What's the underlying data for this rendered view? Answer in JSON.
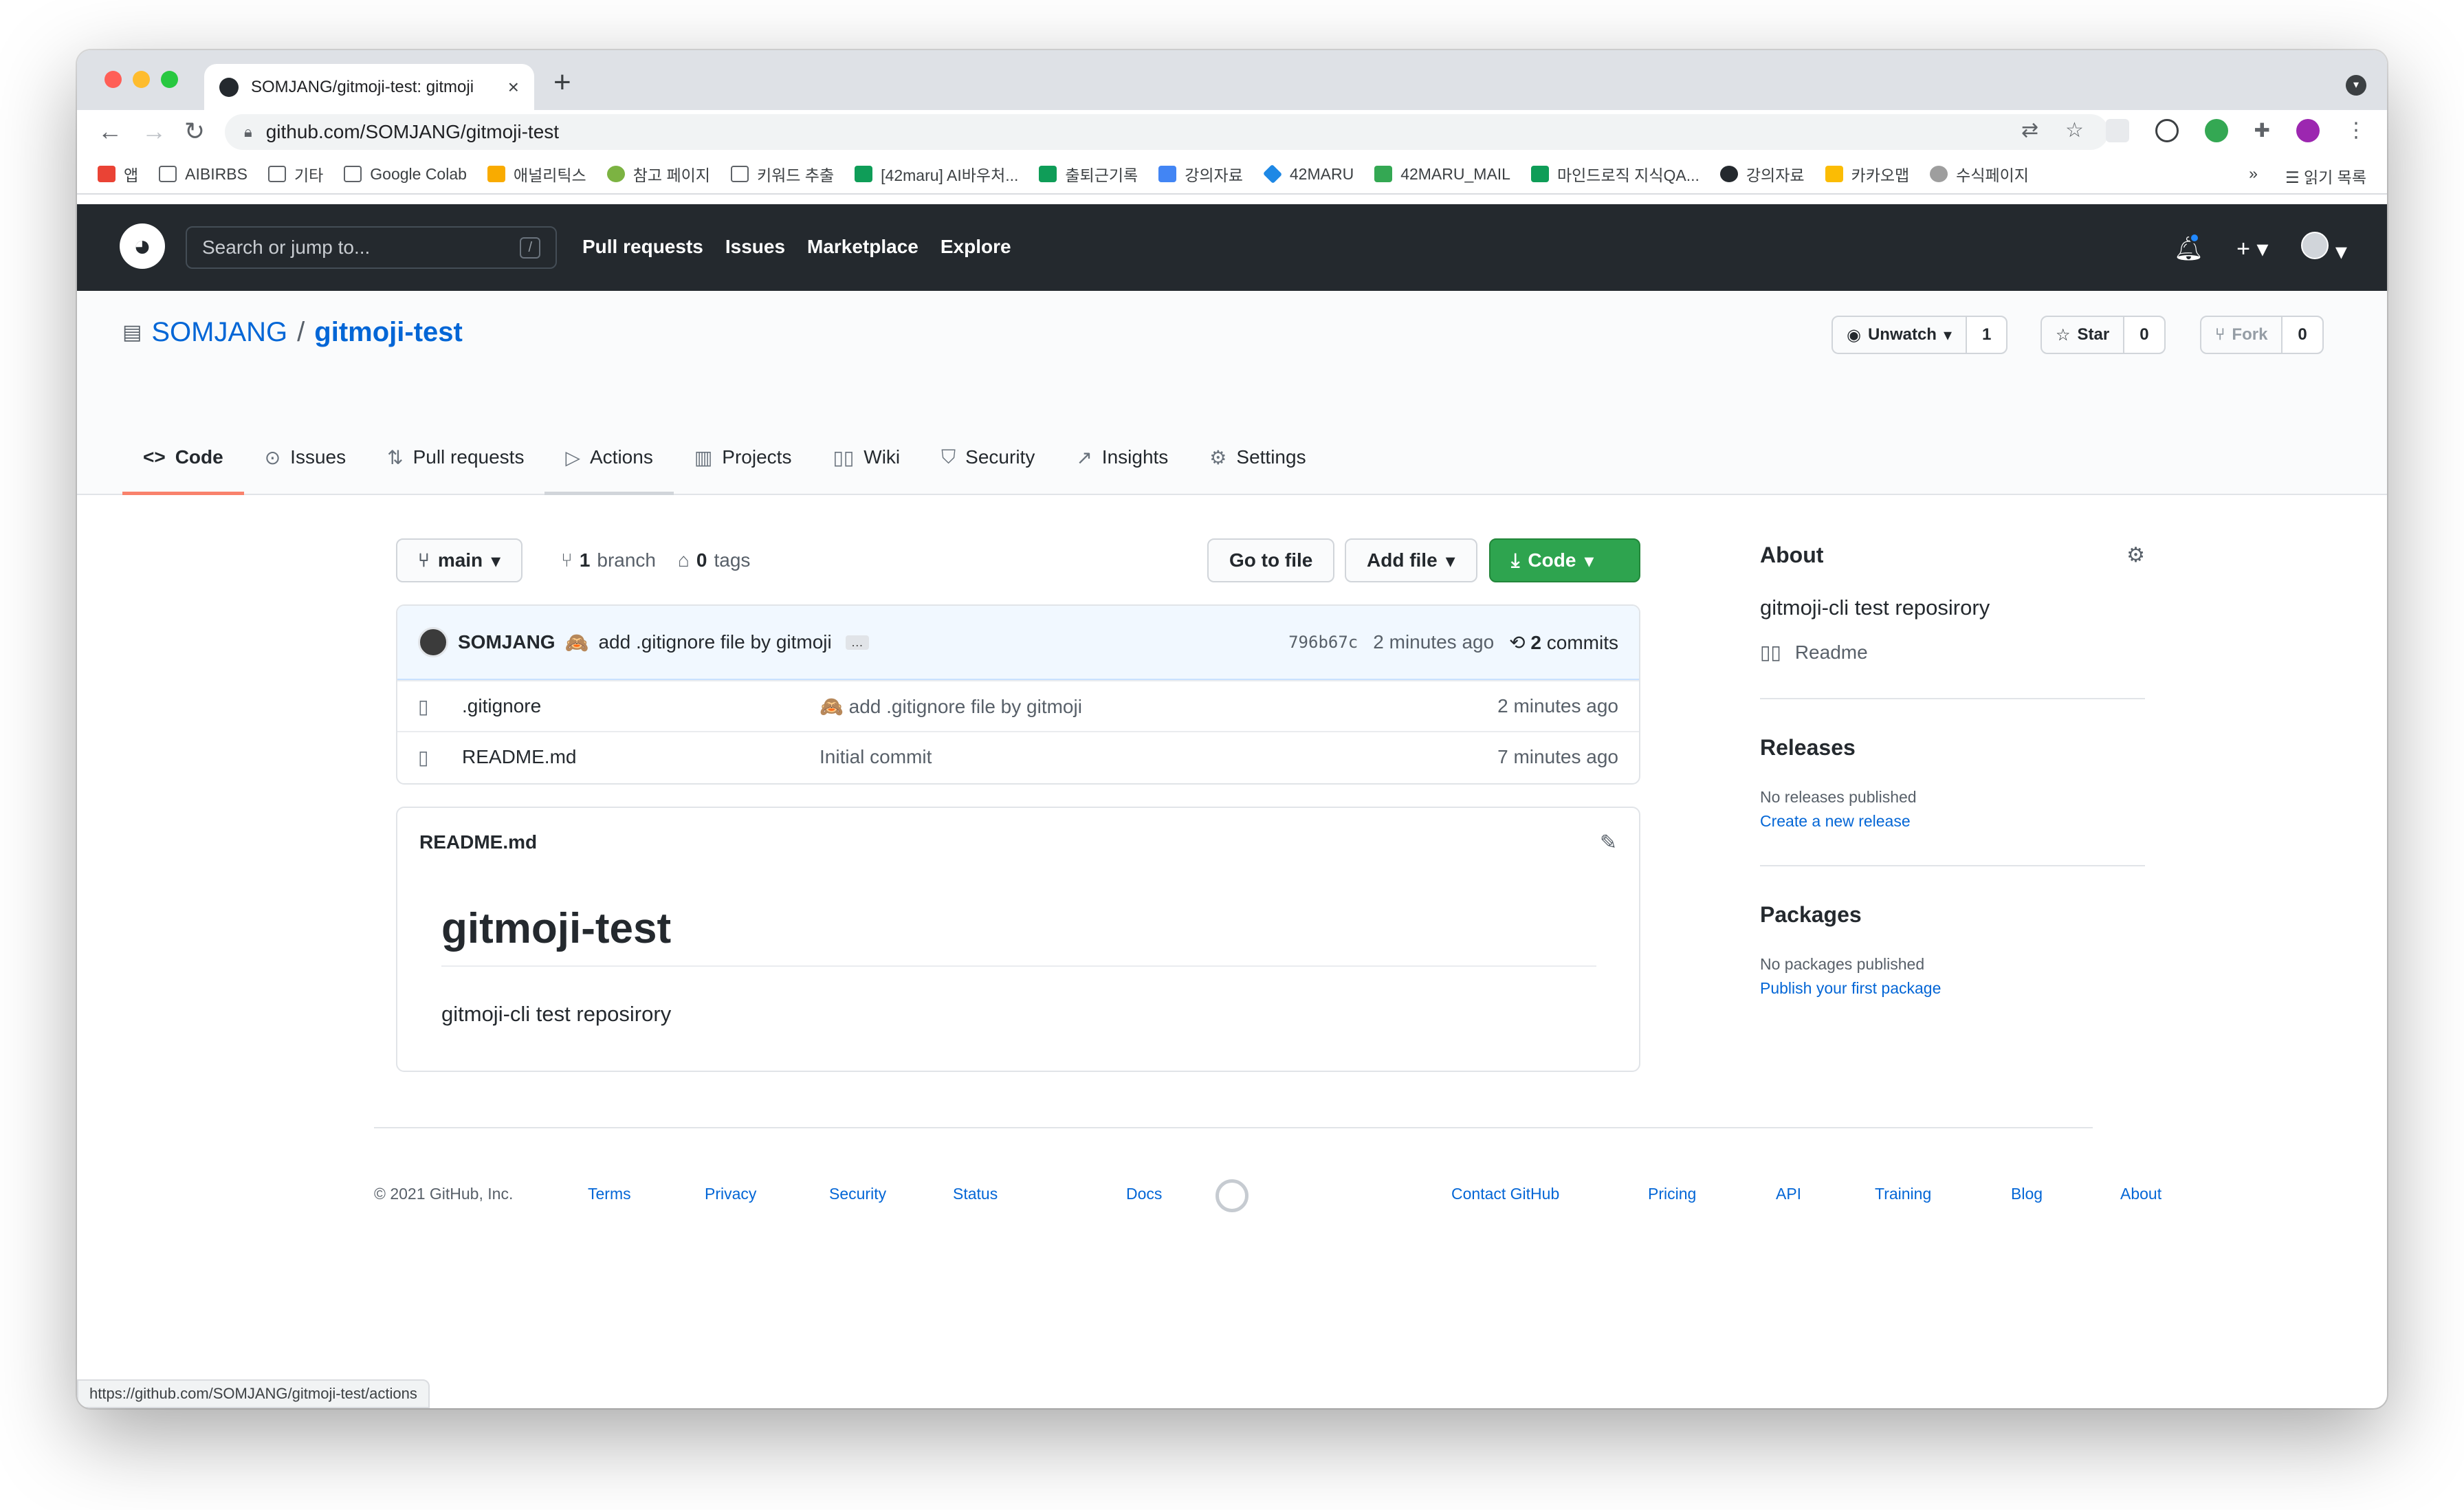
{
  "browser": {
    "tab_title": "SOMJANG/gitmoji-test: gitmoji",
    "url": "github.com/SOMJANG/gitmoji-test",
    "new_tab": "+",
    "bookmarks": [
      {
        "label": "앱",
        "color": "#ea4335"
      },
      {
        "label": "AIBIRBS",
        "color": "#8a8d91"
      },
      {
        "label": "기타",
        "color": "#8a8d91"
      },
      {
        "label": "Google Colab",
        "color": "#8a8d91"
      },
      {
        "label": "애널리틱스",
        "color": "#f9ab00"
      },
      {
        "label": "참고 페이지",
        "color": "#7cb342"
      },
      {
        "label": "키워드 추출",
        "color": "#8a8d91"
      },
      {
        "label": "[42maru] AI바우처...",
        "color": "#0f9d58"
      },
      {
        "label": "출퇴근기록",
        "color": "#0f9d58"
      },
      {
        "label": "강의자료",
        "color": "#4285f4"
      },
      {
        "label": "42MARU",
        "color": "#1e88e5"
      },
      {
        "label": "42MARU_MAIL",
        "color": "#34a853"
      },
      {
        "label": "마인드로직 지식QA...",
        "color": "#0f9d58"
      },
      {
        "label": "강의자료",
        "color": "#24292e"
      },
      {
        "label": "카카오맵",
        "color": "#fbbc04"
      },
      {
        "label": "수식페이지",
        "color": "#9e9e9e"
      }
    ],
    "bookmarks_more": "»",
    "reading_list": "읽기 목록",
    "status_url": "https://github.com/SOMJANG/gitmoji-test/actions"
  },
  "gh_header": {
    "search_placeholder": "Search or jump to...",
    "search_shortcut": "/",
    "nav": [
      "Pull requests",
      "Issues",
      "Marketplace",
      "Explore"
    ]
  },
  "repo": {
    "owner": "SOMJANG",
    "separator": "/",
    "name": "gitmoji-test",
    "watch_label": "Unwatch",
    "watch_count": "1",
    "star_label": "Star",
    "star_count": "0",
    "fork_label": "Fork",
    "fork_count": "0",
    "tabs": [
      {
        "label": "Code",
        "icon": "code-icon"
      },
      {
        "label": "Issues",
        "icon": "issue-icon"
      },
      {
        "label": "Pull requests",
        "icon": "pull-request-icon"
      },
      {
        "label": "Actions",
        "icon": "play-icon"
      },
      {
        "label": "Projects",
        "icon": "project-icon"
      },
      {
        "label": "Wiki",
        "icon": "book-icon"
      },
      {
        "label": "Security",
        "icon": "shield-icon"
      },
      {
        "label": "Insights",
        "icon": "graph-icon"
      },
      {
        "label": "Settings",
        "icon": "gear-icon"
      }
    ]
  },
  "code": {
    "branch": "main",
    "branch_count": "1",
    "branch_label": "branch",
    "tag_count": "0",
    "tag_label": "tags",
    "go_to_file": "Go to file",
    "add_file": "Add file",
    "code_button": "Code",
    "commit": {
      "author": "SOMJANG",
      "emoji": "🙈",
      "message": "add .gitignore file by gitmoji",
      "ellipsis": "…",
      "sha": "796b67c",
      "time": "2 minutes ago",
      "commit_count": "2",
      "commit_label": "commits"
    },
    "files": [
      {
        "name": ".gitignore",
        "message": "🙈 add .gitignore file by gitmoji",
        "age": "2 minutes ago"
      },
      {
        "name": "README.md",
        "message": "Initial commit",
        "age": "7 minutes ago"
      }
    ],
    "readme": {
      "filename": "README.md",
      "heading": "gitmoji-test",
      "body": "gitmoji-cli test reposirory"
    }
  },
  "sidebar": {
    "about_title": "About",
    "description": "gitmoji-cli test reposirory",
    "readme_link": "Readme",
    "releases_title": "Releases",
    "releases_empty": "No releases published",
    "releases_link": "Create a new release",
    "packages_title": "Packages",
    "packages_empty": "No packages published",
    "packages_link": "Publish your first package"
  },
  "footer": {
    "copyright": "© 2021 GitHub, Inc.",
    "left_links": [
      "Terms",
      "Privacy",
      "Security",
      "Status",
      "Docs"
    ],
    "right_links": [
      "Contact GitHub",
      "Pricing",
      "API",
      "Training",
      "Blog",
      "About"
    ]
  },
  "colors": {
    "header_bg": "#24292e",
    "link": "#0366d6",
    "code_button": "#2ea44f",
    "active_tab_underline": "#f9826c"
  }
}
